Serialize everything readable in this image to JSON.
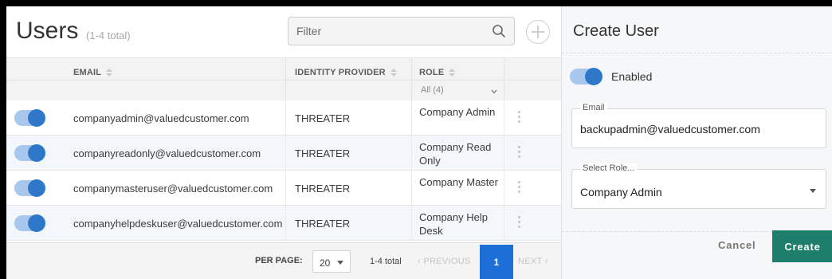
{
  "users": {
    "title": "Users",
    "count_text": "(1-4 total)",
    "filter_placeholder": "Filter",
    "columns": {
      "email": "EMAIL",
      "identity_provider": "IDENTITY PROVIDER",
      "role": "ROLE"
    },
    "role_filter": "All (4)",
    "rows": [
      {
        "enabled": true,
        "email": "companyadmin@valuedcustomer.com",
        "identity_provider": "THREATER",
        "role": "Company Admin"
      },
      {
        "enabled": true,
        "email": "companyreadonly@valuedcustomer.com",
        "identity_provider": "THREATER",
        "role": "Company Read Only"
      },
      {
        "enabled": true,
        "email": "companymasteruser@valuedcustomer.com",
        "identity_provider": "THREATER",
        "role": "Company Master"
      },
      {
        "enabled": true,
        "email": "companyhelpdeskuser@valuedcustomer.com",
        "identity_provider": "THREATER",
        "role": "Company Help Desk"
      }
    ]
  },
  "pagination": {
    "per_page_label": "PER PAGE:",
    "per_page_value": "20",
    "range_text": "1-4 total",
    "prev_label": "PREVIOUS",
    "current_page": "1",
    "next_label": "NEXT"
  },
  "create_user": {
    "title": "Create User",
    "enabled_label": "Enabled",
    "enabled": true,
    "email_label": "Email",
    "email_value": "backupadmin@valuedcustomer.com",
    "role_label": "Select Role...",
    "role_value": "Company Admin",
    "cancel_label": "Cancel",
    "create_label": "Create"
  },
  "colors": {
    "accent_blue": "#2f78c9",
    "toggle_track": "#a9c7ec",
    "page_active": "#1b6fd6",
    "create_button": "#1c7e6b"
  }
}
